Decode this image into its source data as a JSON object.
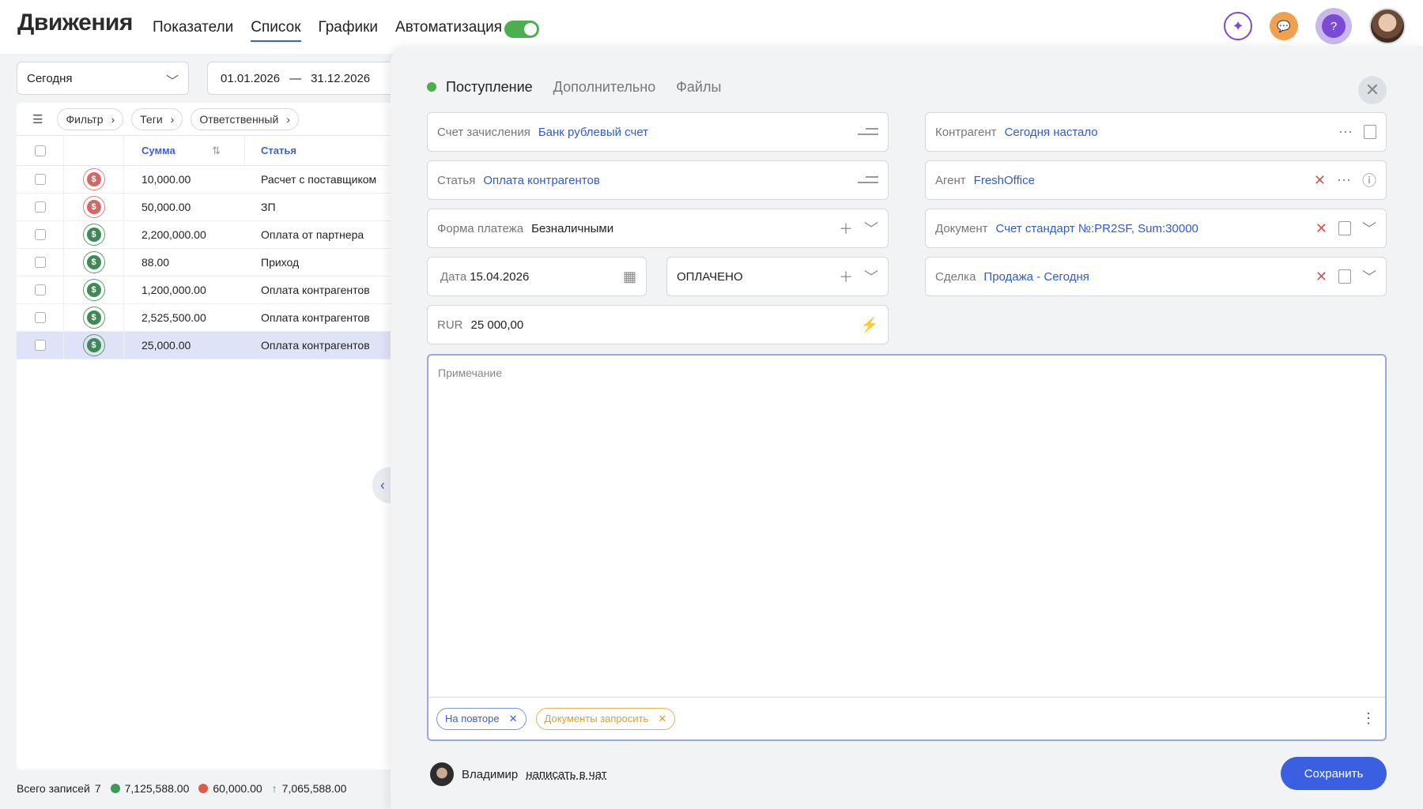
{
  "header": {
    "title": "Движения",
    "tabs": [
      {
        "label": "Показатели"
      },
      {
        "label": "Список"
      },
      {
        "label": "Графики"
      },
      {
        "label": "Автоматизация"
      }
    ]
  },
  "toolbar": {
    "period": "Сегодня",
    "date_from": "01.01.2026",
    "date_sep": "—",
    "date_to": "31.12.2026",
    "filters": [
      "Фильтр",
      "Теги",
      "Ответственный"
    ]
  },
  "table": {
    "columns": {
      "sum": "Сумма",
      "article": "Статья"
    },
    "rows": [
      {
        "type": "red",
        "sum": "10,000.00",
        "article": "Расчет с поставщиком"
      },
      {
        "type": "red",
        "sum": "50,000.00",
        "article": "ЗП"
      },
      {
        "type": "green",
        "sum": "2,200,000.00",
        "article": "Оплата от партнера"
      },
      {
        "type": "green",
        "sum": "88.00",
        "article": "Приход"
      },
      {
        "type": "green",
        "sum": "1,200,000.00",
        "article": "Оплата контрагентов"
      },
      {
        "type": "green",
        "sum": "2,525,500.00",
        "article": "Оплата контрагентов"
      },
      {
        "type": "green",
        "sum": "25,000.00",
        "article": "Оплата контрагентов"
      }
    ]
  },
  "footer": {
    "records_label": "Всего записей",
    "records_count": "7",
    "income": "7,125,588.00",
    "expense": "60,000.00",
    "balance": "7,065,588.00",
    "colors": {
      "income": "#3c9a5a",
      "expense": "#e05a4e",
      "balance": "#3c9a5a"
    }
  },
  "form": {
    "tabs": [
      "Поступление",
      "Дополнительно",
      "Файлы"
    ],
    "account": {
      "label": "Счет зачисления",
      "value": "Банк рублевый счет"
    },
    "article": {
      "label": "Статья",
      "value": "Оплата контрагентов"
    },
    "payment_form": {
      "label": "Форма платежа",
      "value": "Безналичными"
    },
    "date": {
      "label": "Дата",
      "value": "15.04.2026"
    },
    "status": {
      "value": "ОПЛАЧЕНО"
    },
    "amount": {
      "currency": "RUR",
      "value": "25 000,00"
    },
    "counterparty": {
      "label": "Контрагент",
      "value": "Сегодня настало"
    },
    "agent": {
      "label": "Агент",
      "value": "FreshOffice"
    },
    "document": {
      "label": "Документ",
      "value": "Счет стандарт №:PR2SF, Sum:30000"
    },
    "deal": {
      "label": "Сделка",
      "value": "Продажа - Сегодня"
    },
    "note_placeholder": "Примечание",
    "tags": [
      "На повторе",
      "Документы запросить"
    ],
    "author": "Владимир",
    "chat_link": "написать в чат",
    "save_label": "Сохранить"
  },
  "colors": {
    "accent": "#3a5fe0",
    "link": "#2f5ccc",
    "status_green": "#4cae4f"
  }
}
